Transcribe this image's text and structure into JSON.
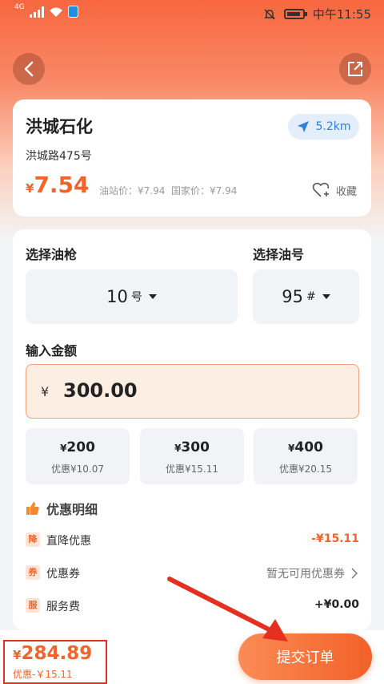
{
  "status_bar": {
    "network": "4G",
    "time": "中午11:55"
  },
  "station": {
    "name": "洪城石化",
    "address": "洪城路475号",
    "distance": "5.2km",
    "price_symbol": "¥",
    "price": "7.54",
    "station_price": "油站价：¥7.94",
    "national_price": "国家价：¥7.94",
    "favorite_label": "收藏"
  },
  "form": {
    "gun_title": "选择油枪",
    "gun_value": "10",
    "gun_suffix": "号",
    "oil_title": "选择油号",
    "oil_value": "95",
    "oil_suffix": "#",
    "amount_title": "输入金额",
    "amount_symbol": "¥",
    "amount_value": "300.00",
    "quick_amounts": [
      {
        "symbol": "¥",
        "value": "200",
        "discount": "优惠¥10.07"
      },
      {
        "symbol": "¥",
        "value": "300",
        "discount": "优惠¥15.11"
      },
      {
        "symbol": "¥",
        "value": "400",
        "discount": "优惠¥20.15"
      }
    ]
  },
  "details": {
    "title": "优惠明细",
    "rows": [
      {
        "tag": "降",
        "label": "直降优惠",
        "value": "-¥15.11"
      },
      {
        "tag": "券",
        "label": "优惠券",
        "value": "暂无可用优惠券"
      },
      {
        "tag": "服",
        "label": "服务费",
        "value": "+¥0.00"
      }
    ]
  },
  "bottom": {
    "total_symbol": "¥",
    "total_value": "284.89",
    "discount_text": "优惠-￥15.11",
    "submit_label": "提交订单"
  },
  "colors": {
    "accent": "#f26428",
    "highlight_annotation": "#e53020"
  }
}
